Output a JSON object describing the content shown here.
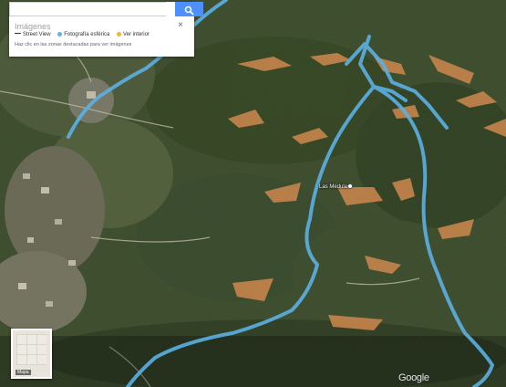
{
  "search": {
    "value": "",
    "placeholder": ""
  },
  "imagery_panel": {
    "title": "Imágenes",
    "close_label": "×",
    "legend": [
      {
        "label": "Street View",
        "icon": "line-icon",
        "color": "#333333"
      },
      {
        "label": "Fotografía esférica",
        "icon": "dot-icon",
        "color": "#5ab4e5"
      },
      {
        "label": "Ver interior",
        "icon": "dot-icon",
        "color": "#f3b52c"
      }
    ],
    "hint": "Haz clic en las zonas destacadas para ver imágenes"
  },
  "map": {
    "place_label": "Las Médulas",
    "layer_switch_label": "Mapa",
    "attribution": "Google",
    "street_view_color": "#5bb0e3"
  }
}
